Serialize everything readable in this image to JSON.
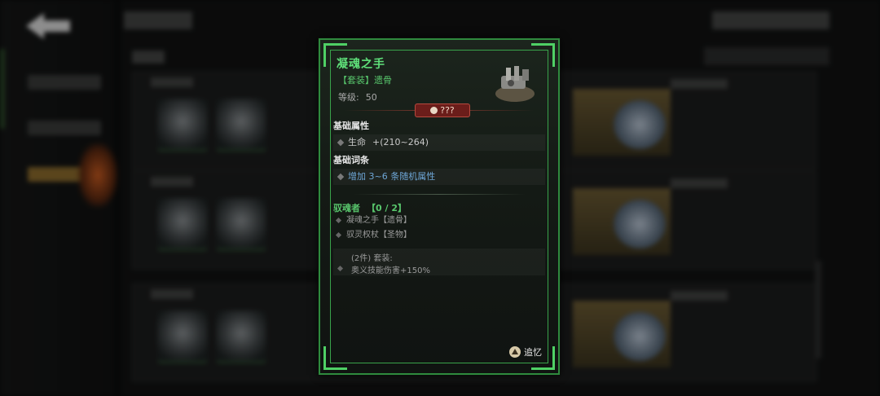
{
  "tooltip": {
    "name": "凝魂之手",
    "set_tag": "【套装】遗骨",
    "level_label": "等级:",
    "level_value": "50",
    "rarity": "???",
    "base_attr_title": "基础属性",
    "base_attr": {
      "label": "生命",
      "value": "+(210~264)"
    },
    "base_affix_title": "基础词条",
    "base_affix": "增加 3~6 条随机属性",
    "set_name": "驭魂者",
    "set_count": "【0 / 2】",
    "set_pieces": [
      "凝魂之手【遗骨】",
      "驭灵权杖【圣物】"
    ],
    "set_bonus_title": "(2件) 套装:",
    "set_bonus": "奥义技能伤害+150%",
    "recall_label": "追忆"
  },
  "icons": {
    "back": "back-arrow-icon",
    "item": "mechanical-gauntlet-icon",
    "rarity": "leaf-icon",
    "recall": "recall-triangle-icon"
  },
  "colors": {
    "name": "#5fe07a",
    "frame": "#2f8a3e",
    "rarity_bg": "#6b1d1a",
    "affix_blue": "#6ea6d6"
  }
}
